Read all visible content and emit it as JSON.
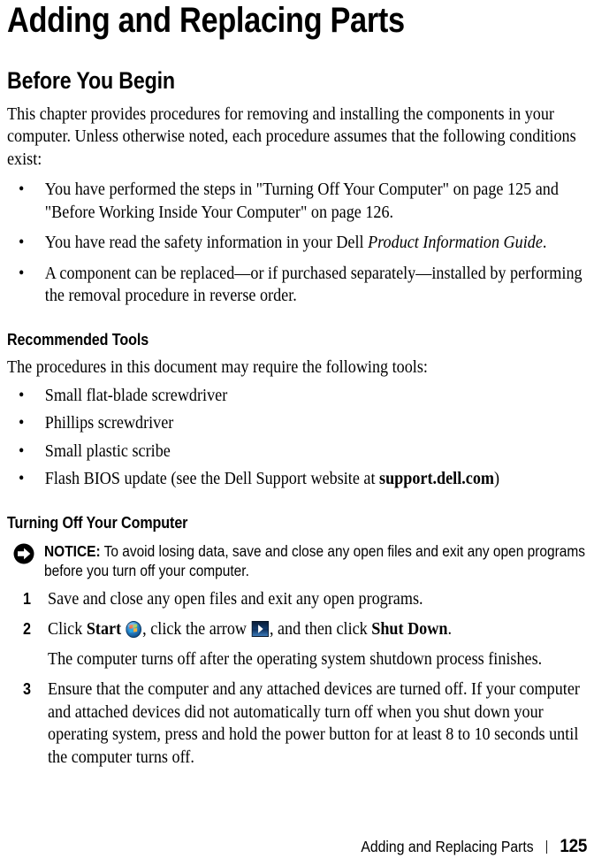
{
  "document": {
    "title": "Adding and Replacing Parts"
  },
  "sections": {
    "before_you_begin": {
      "heading": "Before You Begin",
      "intro": "This chapter provides procedures for removing and installing the components in your computer. Unless otherwise noted, each procedure assumes that the following conditions exist:",
      "conditions": [
        {
          "prefix": "You have performed the steps in \"Turning Off Your Computer\" on page 125 and \"Before Working Inside Your Computer\" on page 126."
        },
        {
          "prefix": "You have read the safety information in your Dell ",
          "italic": "Product Information Guide",
          "suffix": "."
        },
        {
          "prefix": "A component can be replaced—or if purchased separately—installed by performing the removal procedure in reverse order."
        }
      ]
    },
    "recommended_tools": {
      "heading": "Recommended Tools",
      "intro": "The procedures in this document may require the following tools:",
      "tools": [
        {
          "prefix": "Small flat-blade screwdriver"
        },
        {
          "prefix": "Phillips screwdriver"
        },
        {
          "prefix": "Small plastic scribe"
        },
        {
          "prefix": "Flash BIOS update (see the Dell Support website at ",
          "bold": "support.dell.com",
          "suffix": ")"
        }
      ]
    },
    "turning_off": {
      "heading": "Turning Off Your Computer",
      "notice": {
        "label": "NOTICE:",
        "text": " To avoid losing data, save and close any open files and exit any open programs before you turn off your computer.",
        "icon": "notice-arrow-icon"
      },
      "steps": [
        {
          "number": "1",
          "text": "Save and close any open files and exit any open programs."
        },
        {
          "number": "2",
          "segments": {
            "t1": "Click ",
            "b1": "Start",
            "icon1": "windows-start-orb-icon",
            "t2": ", click the arrow ",
            "icon2": "blue-arrow-button-icon",
            "t3": ", and then click ",
            "b2": "Shut Down",
            "t4": "."
          },
          "subtext": "The computer turns off after the operating system shutdown process finishes."
        },
        {
          "number": "3",
          "text": "Ensure that the computer and any attached devices are turned off. If your computer and attached devices did not automatically turn off when you shut down your operating system, press and hold the power button for at least 8 to 10 seconds until the computer turns off."
        }
      ]
    }
  },
  "footer": {
    "running_head": "Adding and Replacing Parts",
    "page_number": "125"
  },
  "colors": {
    "text": "#000000",
    "background": "#ffffff",
    "orb_blue": "#1b6fb8",
    "arrow_button_blue": "#0b2f5e"
  }
}
